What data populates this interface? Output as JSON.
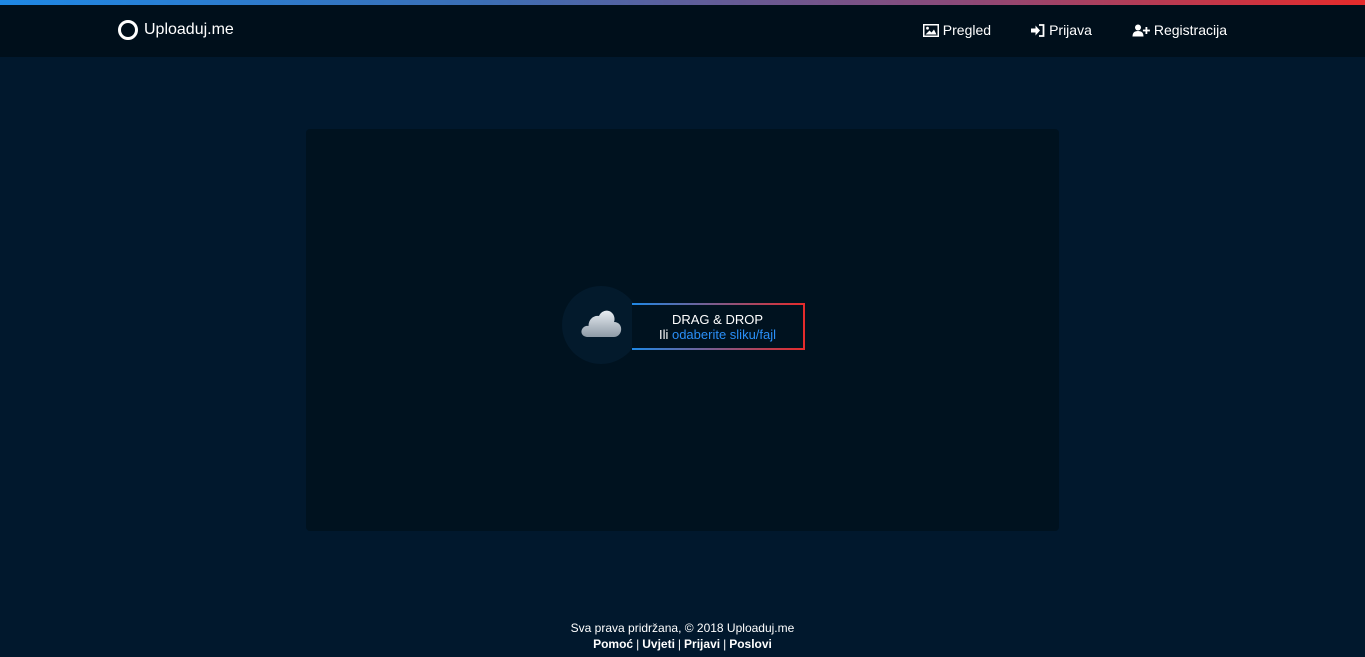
{
  "colors": {
    "background": "#01182d",
    "navbar": "#000f1b",
    "panel": "#00121f",
    "accent_blue": "#1e88e5",
    "accent_red": "#e52b2b",
    "link": "#2a8ff7"
  },
  "header": {
    "brand": "Uploaduj.me",
    "nav": [
      {
        "label": "Pregled",
        "icon": "image-icon"
      },
      {
        "label": "Prijava",
        "icon": "sign-in-icon"
      },
      {
        "label": "Registracija",
        "icon": "user-plus-icon"
      }
    ]
  },
  "upload": {
    "icon": "cloud-icon",
    "title": "DRAG & DROP",
    "or_text": "Ili",
    "select_link": "odaberite sliku/fajl"
  },
  "footer": {
    "copyright": "Sva prava pridržana, © 2018 Uploaduj.me",
    "links": [
      "Pomoć",
      "Uvjeti",
      "Prijavi",
      "Poslovi"
    ],
    "separator": "|"
  }
}
